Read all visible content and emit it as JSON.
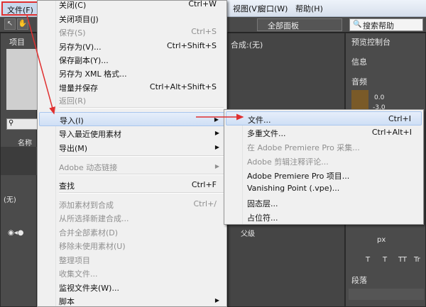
{
  "menubar": {
    "file": "文件(F)",
    "view": "视图(V)",
    "window": "窗口(W)",
    "help": "帮助(H)"
  },
  "toolbar": {
    "workspace": "全部面板",
    "search_help": "搜索帮助"
  },
  "panels": {
    "project_tab": "项目",
    "name_column": "名称",
    "composition_tab": "合成:(无)",
    "preview_tab": "预览控制台",
    "info_tab": "信息",
    "audio_tab": "音频",
    "audio_level_top": "0.0",
    "audio_level_mid": "-3.0",
    "timeline_tab": "(无)",
    "parent_label": "父级",
    "paragraph_tab": "段落",
    "px_unit": "px",
    "text_styles": [
      "T",
      "T",
      "TT",
      "Tr"
    ]
  },
  "file_menu": {
    "items": [
      {
        "label": "关闭(C)",
        "shortcut": "Ctrl+W",
        "disabled": false
      },
      {
        "label": "关闭项目(J)",
        "shortcut": "",
        "disabled": false
      },
      {
        "label": "保存(S)",
        "shortcut": "Ctrl+S",
        "disabled": true
      },
      {
        "label": "另存为(V)...",
        "shortcut": "Ctrl+Shift+S",
        "disabled": false
      },
      {
        "label": "保存副本(Y)...",
        "shortcut": "",
        "disabled": false
      },
      {
        "label": "另存为 XML 格式...",
        "shortcut": "",
        "disabled": false
      },
      {
        "label": "增量并保存",
        "shortcut": "Ctrl+Alt+Shift+S",
        "disabled": false
      },
      {
        "label": "返回(R)",
        "shortcut": "",
        "disabled": true
      },
      {
        "label": "导入(I)",
        "shortcut": "",
        "disabled": false,
        "submenu": true,
        "highlighted": true
      },
      {
        "label": "导入最近使用素材",
        "shortcut": "",
        "disabled": false,
        "submenu": true
      },
      {
        "label": "导出(M)",
        "shortcut": "",
        "disabled": false,
        "submenu": true
      },
      {
        "label": "Adobe 动态链接",
        "shortcut": "",
        "disabled": true,
        "submenu": true
      },
      {
        "label": "查找",
        "shortcut": "Ctrl+F",
        "disabled": false
      },
      {
        "label": "添加素材到合成",
        "shortcut": "Ctrl+/",
        "disabled": true
      },
      {
        "label": "从所选择新建合成...",
        "shortcut": "",
        "disabled": true
      },
      {
        "label": "合并全部素材(D)",
        "shortcut": "",
        "disabled": true
      },
      {
        "label": "移除未使用素材(U)",
        "shortcut": "",
        "disabled": true
      },
      {
        "label": "整理项目",
        "shortcut": "",
        "disabled": true
      },
      {
        "label": "收集文件...",
        "shortcut": "",
        "disabled": true
      },
      {
        "label": "监视文件夹(W)...",
        "shortcut": "",
        "disabled": false
      },
      {
        "label": "脚本",
        "shortcut": "",
        "disabled": false,
        "submenu": true
      }
    ]
  },
  "import_submenu": {
    "items": [
      {
        "label": "文件...",
        "shortcut": "Ctrl+I",
        "disabled": false,
        "highlighted": true
      },
      {
        "label": "多重文件...",
        "shortcut": "Ctrl+Alt+I",
        "disabled": false
      },
      {
        "label": "在 Adobe Premiere Pro 采集...",
        "shortcut": "",
        "disabled": true
      },
      {
        "label": "Adobe 剪辑注释评论...",
        "shortcut": "",
        "disabled": true
      },
      {
        "label": "Adobe Premiere Pro 项目...",
        "shortcut": "",
        "disabled": false
      },
      {
        "label": "Vanishing Point (.vpe)...",
        "shortcut": "",
        "disabled": false
      },
      {
        "label": "固态层...",
        "shortcut": "",
        "disabled": false
      },
      {
        "label": "占位符...",
        "shortcut": "",
        "disabled": false
      }
    ]
  },
  "colors": {
    "annotation_red": "#e03030",
    "menu_bg": "#f0f0f0",
    "highlight_border": "#a8c6ee"
  }
}
